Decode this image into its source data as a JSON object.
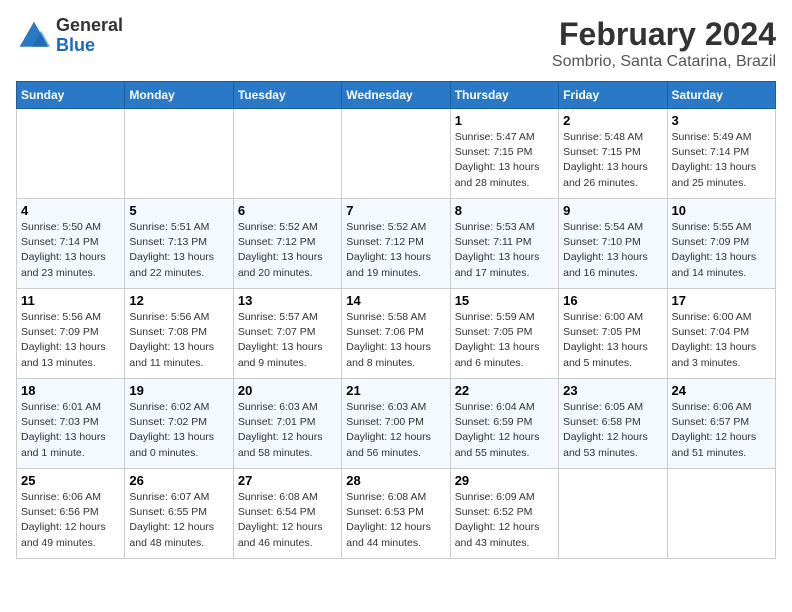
{
  "header": {
    "logo_line1": "General",
    "logo_line2": "Blue",
    "main_title": "February 2024",
    "sub_title": "Sombrio, Santa Catarina, Brazil"
  },
  "weekdays": [
    "Sunday",
    "Monday",
    "Tuesday",
    "Wednesday",
    "Thursday",
    "Friday",
    "Saturday"
  ],
  "weeks": [
    [
      {
        "num": "",
        "detail": ""
      },
      {
        "num": "",
        "detail": ""
      },
      {
        "num": "",
        "detail": ""
      },
      {
        "num": "",
        "detail": ""
      },
      {
        "num": "1",
        "detail": "Sunrise: 5:47 AM\nSunset: 7:15 PM\nDaylight: 13 hours\nand 28 minutes."
      },
      {
        "num": "2",
        "detail": "Sunrise: 5:48 AM\nSunset: 7:15 PM\nDaylight: 13 hours\nand 26 minutes."
      },
      {
        "num": "3",
        "detail": "Sunrise: 5:49 AM\nSunset: 7:14 PM\nDaylight: 13 hours\nand 25 minutes."
      }
    ],
    [
      {
        "num": "4",
        "detail": "Sunrise: 5:50 AM\nSunset: 7:14 PM\nDaylight: 13 hours\nand 23 minutes."
      },
      {
        "num": "5",
        "detail": "Sunrise: 5:51 AM\nSunset: 7:13 PM\nDaylight: 13 hours\nand 22 minutes."
      },
      {
        "num": "6",
        "detail": "Sunrise: 5:52 AM\nSunset: 7:12 PM\nDaylight: 13 hours\nand 20 minutes."
      },
      {
        "num": "7",
        "detail": "Sunrise: 5:52 AM\nSunset: 7:12 PM\nDaylight: 13 hours\nand 19 minutes."
      },
      {
        "num": "8",
        "detail": "Sunrise: 5:53 AM\nSunset: 7:11 PM\nDaylight: 13 hours\nand 17 minutes."
      },
      {
        "num": "9",
        "detail": "Sunrise: 5:54 AM\nSunset: 7:10 PM\nDaylight: 13 hours\nand 16 minutes."
      },
      {
        "num": "10",
        "detail": "Sunrise: 5:55 AM\nSunset: 7:09 PM\nDaylight: 13 hours\nand 14 minutes."
      }
    ],
    [
      {
        "num": "11",
        "detail": "Sunrise: 5:56 AM\nSunset: 7:09 PM\nDaylight: 13 hours\nand 13 minutes."
      },
      {
        "num": "12",
        "detail": "Sunrise: 5:56 AM\nSunset: 7:08 PM\nDaylight: 13 hours\nand 11 minutes."
      },
      {
        "num": "13",
        "detail": "Sunrise: 5:57 AM\nSunset: 7:07 PM\nDaylight: 13 hours\nand 9 minutes."
      },
      {
        "num": "14",
        "detail": "Sunrise: 5:58 AM\nSunset: 7:06 PM\nDaylight: 13 hours\nand 8 minutes."
      },
      {
        "num": "15",
        "detail": "Sunrise: 5:59 AM\nSunset: 7:05 PM\nDaylight: 13 hours\nand 6 minutes."
      },
      {
        "num": "16",
        "detail": "Sunrise: 6:00 AM\nSunset: 7:05 PM\nDaylight: 13 hours\nand 5 minutes."
      },
      {
        "num": "17",
        "detail": "Sunrise: 6:00 AM\nSunset: 7:04 PM\nDaylight: 13 hours\nand 3 minutes."
      }
    ],
    [
      {
        "num": "18",
        "detail": "Sunrise: 6:01 AM\nSunset: 7:03 PM\nDaylight: 13 hours\nand 1 minute."
      },
      {
        "num": "19",
        "detail": "Sunrise: 6:02 AM\nSunset: 7:02 PM\nDaylight: 13 hours\nand 0 minutes."
      },
      {
        "num": "20",
        "detail": "Sunrise: 6:03 AM\nSunset: 7:01 PM\nDaylight: 12 hours\nand 58 minutes."
      },
      {
        "num": "21",
        "detail": "Sunrise: 6:03 AM\nSunset: 7:00 PM\nDaylight: 12 hours\nand 56 minutes."
      },
      {
        "num": "22",
        "detail": "Sunrise: 6:04 AM\nSunset: 6:59 PM\nDaylight: 12 hours\nand 55 minutes."
      },
      {
        "num": "23",
        "detail": "Sunrise: 6:05 AM\nSunset: 6:58 PM\nDaylight: 12 hours\nand 53 minutes."
      },
      {
        "num": "24",
        "detail": "Sunrise: 6:06 AM\nSunset: 6:57 PM\nDaylight: 12 hours\nand 51 minutes."
      }
    ],
    [
      {
        "num": "25",
        "detail": "Sunrise: 6:06 AM\nSunset: 6:56 PM\nDaylight: 12 hours\nand 49 minutes."
      },
      {
        "num": "26",
        "detail": "Sunrise: 6:07 AM\nSunset: 6:55 PM\nDaylight: 12 hours\nand 48 minutes."
      },
      {
        "num": "27",
        "detail": "Sunrise: 6:08 AM\nSunset: 6:54 PM\nDaylight: 12 hours\nand 46 minutes."
      },
      {
        "num": "28",
        "detail": "Sunrise: 6:08 AM\nSunset: 6:53 PM\nDaylight: 12 hours\nand 44 minutes."
      },
      {
        "num": "29",
        "detail": "Sunrise: 6:09 AM\nSunset: 6:52 PM\nDaylight: 12 hours\nand 43 minutes."
      },
      {
        "num": "",
        "detail": ""
      },
      {
        "num": "",
        "detail": ""
      }
    ]
  ]
}
